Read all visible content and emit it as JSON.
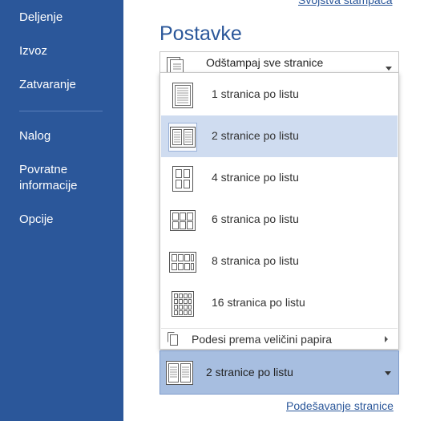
{
  "sidebar": {
    "items": [
      {
        "label": "Deljenje"
      },
      {
        "label": "Izvoz"
      },
      {
        "label": "Zatvaranje"
      },
      {
        "label": "Nalog"
      },
      {
        "label": "Povratne informacije"
      },
      {
        "label": "Opcije"
      }
    ]
  },
  "header": {
    "printer_link": "Svojstva štampača",
    "section_title": "Postavke"
  },
  "print_range": {
    "label": "Odštampaj sve stranice",
    "icon": "document-stack-icon"
  },
  "pages_per_sheet_menu": {
    "options": [
      {
        "label": "1 stranica po listu",
        "icon": "one-page-icon"
      },
      {
        "label": "2 stranice po listu",
        "icon": "two-pages-icon",
        "selected": true
      },
      {
        "label": "4 stranice po listu",
        "icon": "four-pages-icon"
      },
      {
        "label": "6 stranica po listu",
        "icon": "six-pages-icon"
      },
      {
        "label": "8 stranica po listu",
        "icon": "eight-pages-icon"
      },
      {
        "label": "16 stranica po listu",
        "icon": "sixteen-pages-icon"
      }
    ],
    "fit_label": "Podesi prema veličini papira"
  },
  "current_selection": {
    "label": "2 stranice po listu",
    "icon": "two-pages-icon"
  },
  "footer": {
    "page_setup_link": "Podešavanje stranice"
  },
  "colors": {
    "sidebar": "#2b579a",
    "accent": "#2b579a",
    "selected_option": "#cfdcf0",
    "active_control": "#a7bee0"
  }
}
